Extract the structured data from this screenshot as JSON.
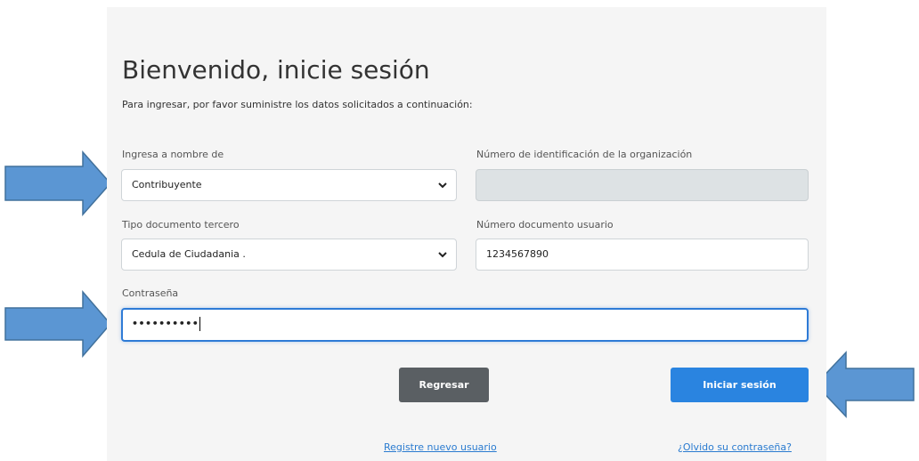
{
  "page": {
    "title": "Bienvenido, inicie sesión",
    "subtitle": "Para ingresar, por favor suministre los datos solicitados a continuación:"
  },
  "form": {
    "ingresa": {
      "label": "Ingresa a nombre de",
      "selected": "Contribuyente"
    },
    "nit": {
      "label": "Número de identificación de la organización",
      "value": ""
    },
    "tipo_doc": {
      "label": "Tipo documento tercero",
      "selected": "Cedula de Ciudadania ."
    },
    "num_doc": {
      "label": "Número documento usuario",
      "value": "1234567890"
    },
    "password": {
      "label": "Contraseña",
      "masked_value": "••••••••••"
    }
  },
  "buttons": {
    "back_label": "Regresar",
    "login_label": "Iniciar sesión"
  },
  "links": {
    "register": "Registre nuevo usuario",
    "forgot": "¿Olvido su contraseña?"
  },
  "icons": {
    "select_chevron": "chevron-down-icon",
    "annotation_arrows": "blue-arrow-icon"
  },
  "colors": {
    "panel_background": "#f5f5f5",
    "login_button": "#2a84e0",
    "back_button": "#5a5f63",
    "focus_border": "#2e7bd6",
    "link": "#2a7bd0",
    "annotation_arrow_fill": "#5b96d3",
    "annotation_arrow_stroke": "#41719c"
  }
}
